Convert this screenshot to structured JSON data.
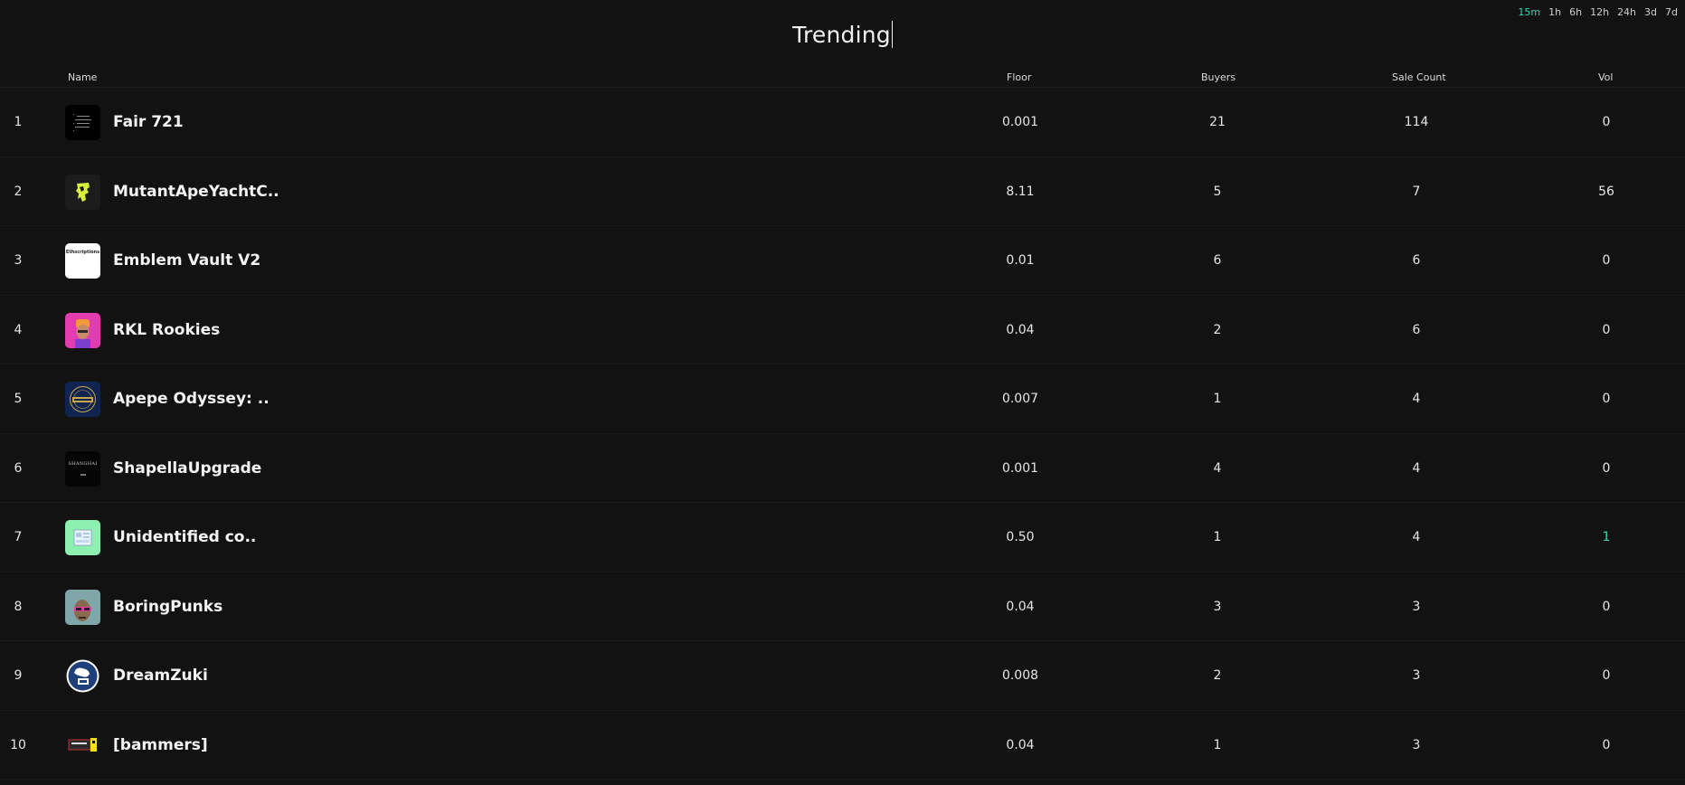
{
  "timeframes": [
    {
      "label": "15m",
      "active": true
    },
    {
      "label": "1h",
      "active": false
    },
    {
      "label": "6h",
      "active": false
    },
    {
      "label": "12h",
      "active": false
    },
    {
      "label": "24h",
      "active": false
    },
    {
      "label": "3d",
      "active": false
    },
    {
      "label": "7d",
      "active": false
    }
  ],
  "title": "Trending",
  "columns": {
    "name": "Name",
    "floor": "Floor",
    "buyers": "Buyers",
    "sale_count": "Sale Count",
    "vol": "Vol"
  },
  "colors": {
    "accent": "#2fd9b0",
    "background": "#121212"
  },
  "rows": [
    {
      "rank": "1",
      "name": "Fair 721",
      "floor": "0.001",
      "buyers": "21",
      "sales": "114",
      "vol": "0",
      "icon": "fair721-thumbnail"
    },
    {
      "rank": "2",
      "name": "MutantApeYachtC..",
      "floor": "8.11",
      "buyers": "5",
      "sales": "7",
      "vol": "56",
      "icon": "mayc-thumbnail"
    },
    {
      "rank": "3",
      "name": "Emblem Vault V2",
      "floor": "0.01",
      "buyers": "6",
      "sales": "6",
      "vol": "0",
      "icon": "emblem-vault-thumbnail",
      "thumb_text": "Ethscriptions"
    },
    {
      "rank": "4",
      "name": "RKL Rookies",
      "floor": "0.04",
      "buyers": "2",
      "sales": "6",
      "vol": "0",
      "icon": "rkl-rookies-thumbnail"
    },
    {
      "rank": "5",
      "name": "Apepe Odyssey: ..",
      "floor": "0.007",
      "buyers": "1",
      "sales": "4",
      "vol": "0",
      "icon": "apepe-odyssey-thumbnail"
    },
    {
      "rank": "6",
      "name": "ShapellaUpgrade",
      "floor": "0.001",
      "buyers": "4",
      "sales": "4",
      "vol": "0",
      "icon": "shapella-thumbnail",
      "thumb_text": "SHANGHAI"
    },
    {
      "rank": "7",
      "name": "Unidentified co..",
      "floor": "0.50",
      "buyers": "1",
      "sales": "4",
      "vol": "1",
      "icon": "unidentified-thumbnail"
    },
    {
      "rank": "8",
      "name": "BoringPunks",
      "floor": "0.04",
      "buyers": "3",
      "sales": "3",
      "vol": "0",
      "icon": "boringpunks-thumbnail"
    },
    {
      "rank": "9",
      "name": "DreamZuki",
      "floor": "0.008",
      "buyers": "2",
      "sales": "3",
      "vol": "0",
      "icon": "dreamzuki-thumbnail"
    },
    {
      "rank": "10",
      "name": "[bammers]",
      "floor": "0.04",
      "buyers": "1",
      "sales": "3",
      "vol": "0",
      "icon": "bammers-thumbnail"
    }
  ]
}
